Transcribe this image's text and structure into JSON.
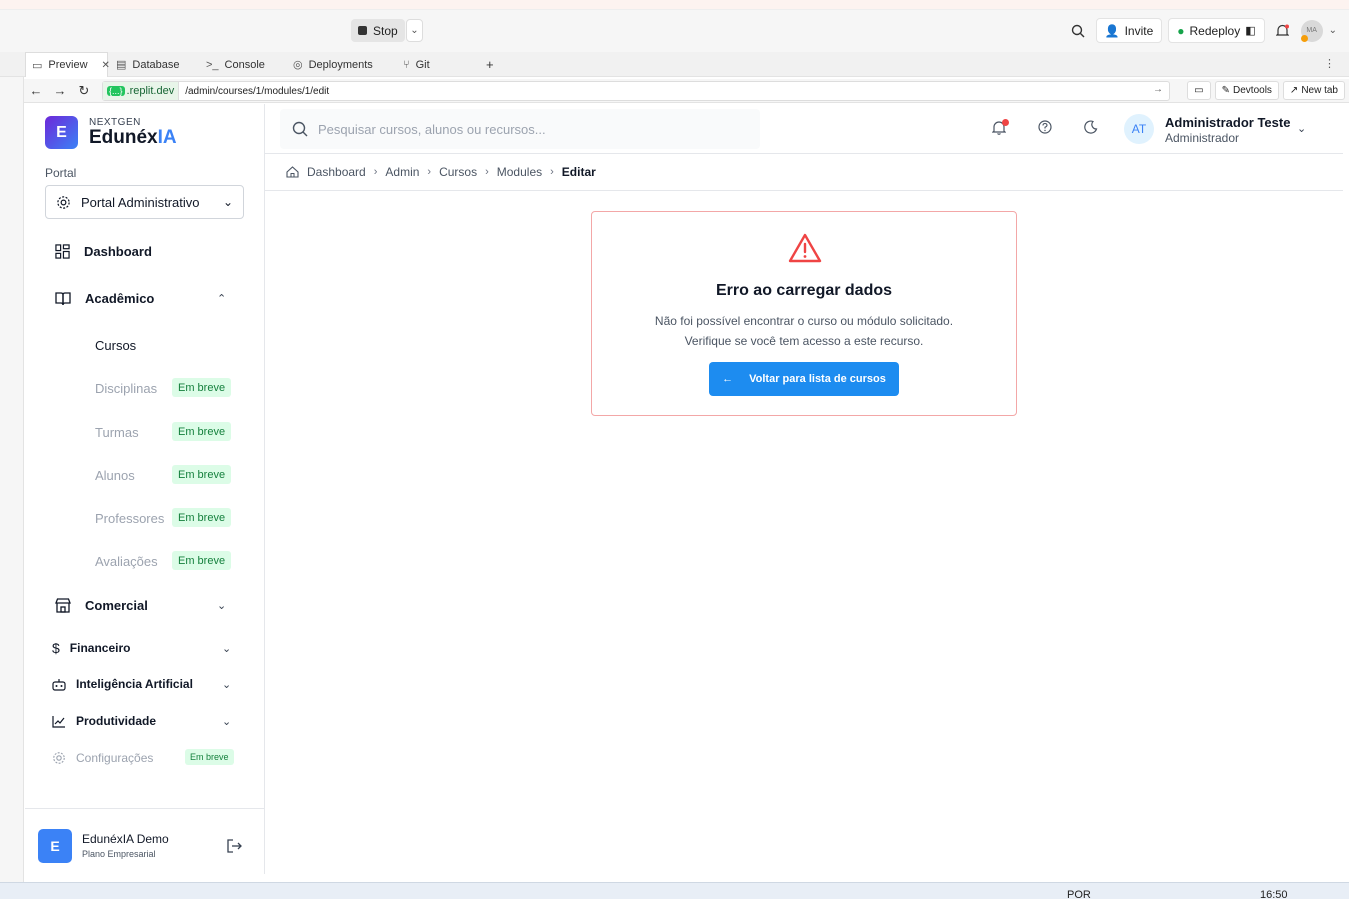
{
  "ide": {
    "stop_label": "Stop",
    "invite_label": "Invite",
    "redeploy_label": "Redeploy",
    "avatar_initials": "MA",
    "tabs": [
      {
        "label": "Preview",
        "icon": "monitor-icon"
      },
      {
        "label": "Database",
        "icon": "database-icon"
      },
      {
        "label": "Console",
        "icon": "terminal-icon"
      },
      {
        "label": "Deployments",
        "icon": "deploy-icon"
      },
      {
        "label": "Git",
        "icon": "git-icon"
      }
    ],
    "url_host": ".replit.dev",
    "url_host_dots": "{...}",
    "url_path": "/admin/courses/1/modules/1/edit",
    "devtools_label": "Devtools",
    "newtab_label": "New tab"
  },
  "brand": {
    "small": "NEXTGEN",
    "name_main": "Edunéx",
    "name_accent": "IA",
    "logo_letter": "E"
  },
  "sidebar": {
    "portal_label": "Portal",
    "portal_value": "Portal Administrativo",
    "dashboard": "Dashboard",
    "academico": "Acadêmico",
    "academico_items": [
      {
        "label": "Cursos",
        "badge": ""
      },
      {
        "label": "Disciplinas",
        "badge": "Em breve"
      },
      {
        "label": "Turmas",
        "badge": "Em breve"
      },
      {
        "label": "Alunos",
        "badge": "Em breve"
      },
      {
        "label": "Professores",
        "badge": "Em breve"
      },
      {
        "label": "Avaliações",
        "badge": "Em breve"
      }
    ],
    "comercial": "Comercial",
    "financeiro": "Financeiro",
    "ia": "Inteligência Artificial",
    "produtividade": "Produtividade",
    "configuracoes": "Configurações",
    "configuracoes_badge": "Em breve",
    "footer_letter": "E",
    "footer_name": "EdunéxIA Demo",
    "footer_plan": "Plano Empresarial"
  },
  "header": {
    "search_placeholder": "Pesquisar cursos, alunos ou recursos...",
    "user_initials": "AT",
    "user_name": "Administrador Teste",
    "user_role": "Administrador"
  },
  "breadcrumb": [
    "Dashboard",
    "Admin",
    "Cursos",
    "Modules",
    "Editar"
  ],
  "error": {
    "title": "Erro ao carregar dados",
    "line1": "Não foi possível encontrar o curso ou módulo solicitado.",
    "line2": "Verifique se você tem acesso a este recurso.",
    "button": "Voltar para lista de cursos"
  },
  "taskbar": {
    "lang": "POR",
    "time": "16:50"
  },
  "colors": {
    "primary": "#1d8cf0",
    "danger": "#ef4444",
    "badge_bg": "#dcfce7",
    "badge_text": "#15803d"
  }
}
